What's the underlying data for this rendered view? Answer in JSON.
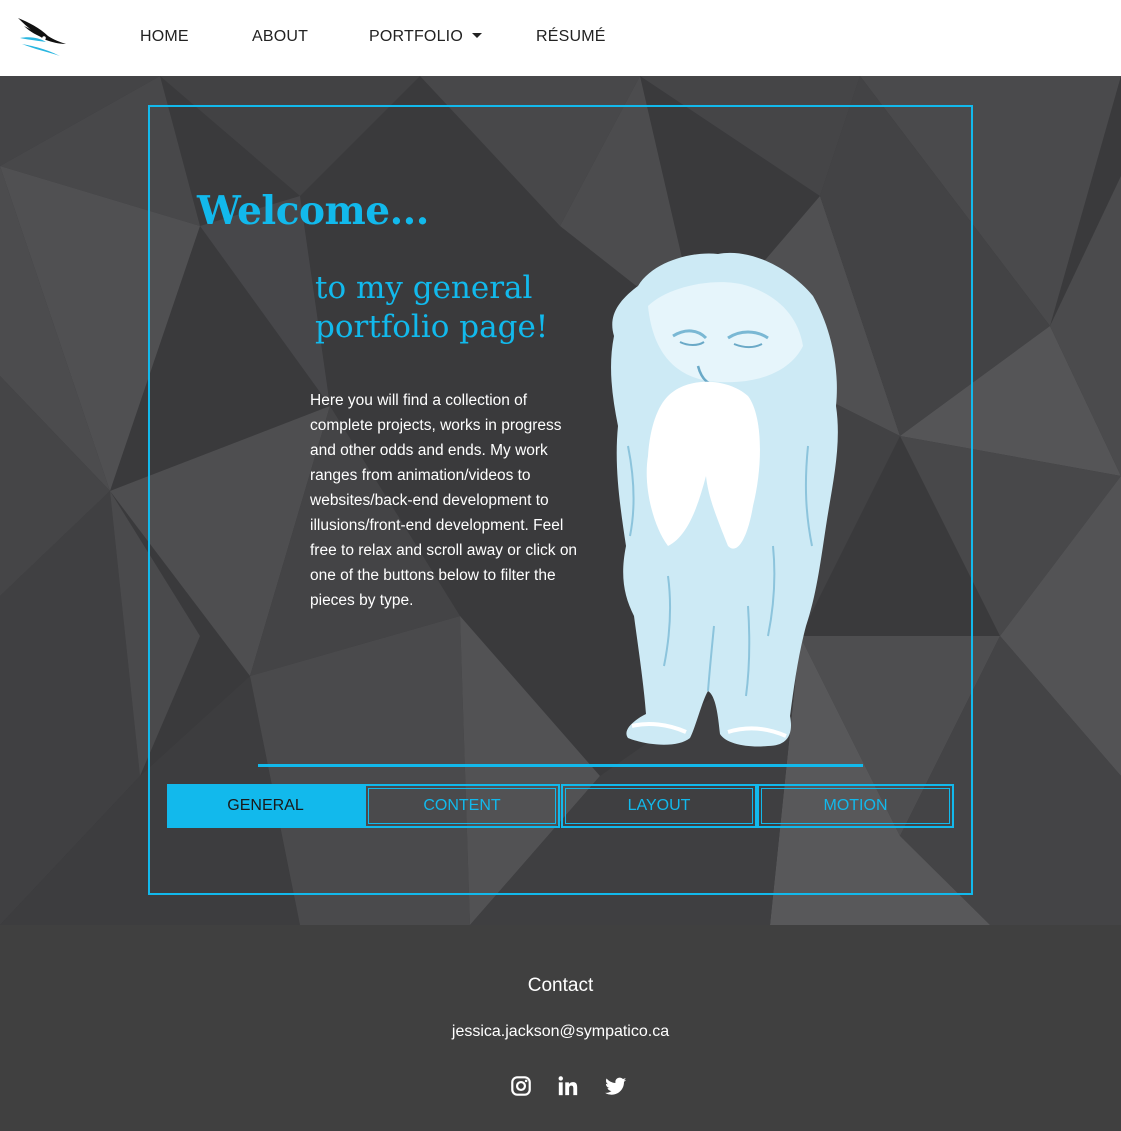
{
  "nav": {
    "items": [
      "HOME",
      "ABOUT",
      "PORTFOLIO",
      "RÉSUMÉ"
    ],
    "logo_icon": "bird-logo-icon",
    "dropdown_icon": "caret-down-icon"
  },
  "hero": {
    "welcome": "Welcome...",
    "subtitle": "to my general portfolio page!",
    "intro": "Here you will find a collection of complete projects, works in progress and other odds and ends. My work ranges from animation/videos to websites/back-end development to illusions/front-end development. Feel free to relax and scroll away or click on one of the buttons below to filter the pieces by type.",
    "mascot_icon": "yeti-illustration"
  },
  "filters": {
    "buttons": [
      "GENERAL",
      "CONTENT",
      "LAYOUT",
      "MOTION"
    ],
    "active": "GENERAL"
  },
  "footer": {
    "contact_title": "Contact",
    "email": "jessica.jackson@sympatico.ca",
    "social_icons": [
      "instagram-icon",
      "linkedin-icon",
      "twitter-icon"
    ]
  },
  "colors": {
    "accent": "#12b9ec",
    "nav_bg": "#ffffff",
    "hero_bg": "#3b3b3d",
    "footer_bg": "#404040"
  }
}
